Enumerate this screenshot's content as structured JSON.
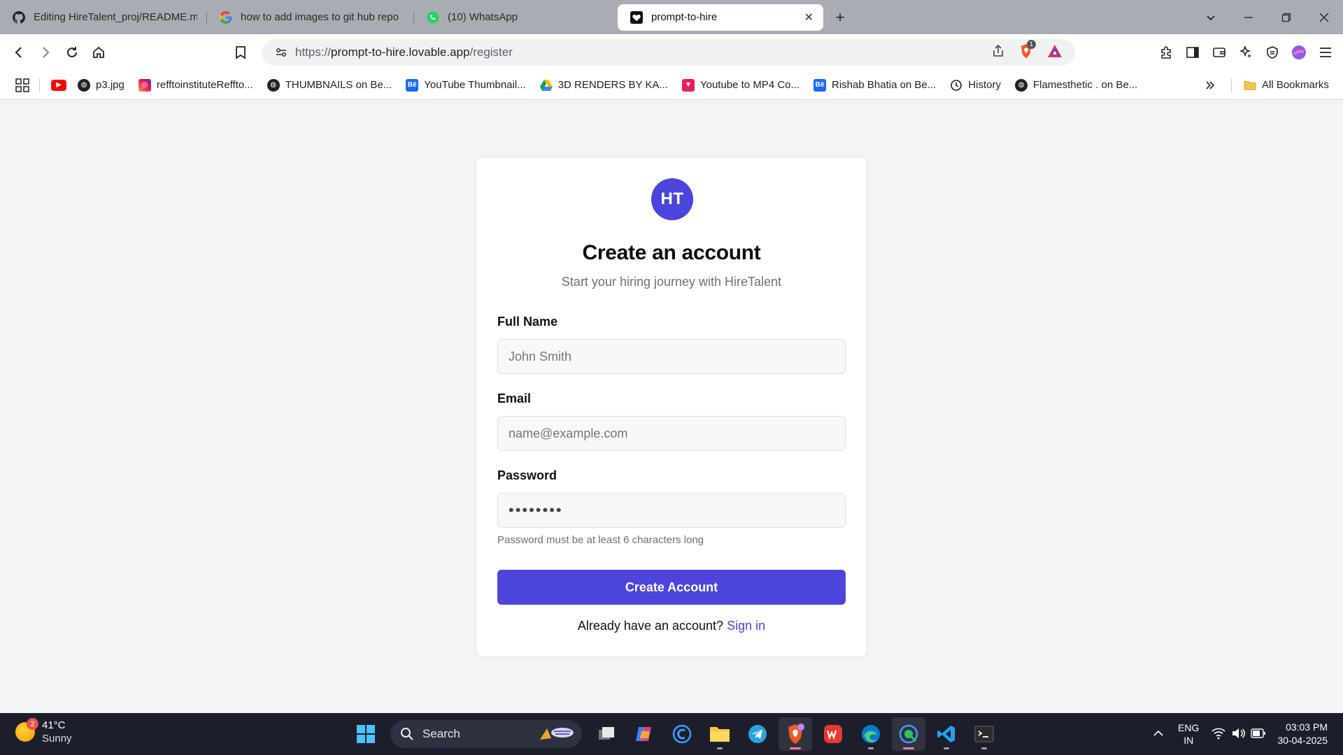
{
  "browser": {
    "tabs": [
      {
        "title": "Editing HireTalent_proj/README.md",
        "icon": "github-icon",
        "active": false
      },
      {
        "title": "how to add images to git hub repo",
        "icon": "google-icon",
        "active": false
      },
      {
        "title": "(10) WhatsApp",
        "icon": "whatsapp-icon",
        "active": false
      },
      {
        "title": "prompt-to-hire",
        "icon": "heart-icon",
        "active": true
      }
    ],
    "new_tab": "+",
    "address": {
      "scheme": "https://",
      "host": "prompt-to-hire.lovable.app",
      "path": "/register"
    },
    "shields_count": "1",
    "bookmarks": [
      {
        "label": "p3.jpg",
        "icon": "globe-icon"
      },
      {
        "label": "refftoinstituteReffto...",
        "icon": "instagram-icon"
      },
      {
        "label": "THUMBNAILS on Be...",
        "icon": "globe-icon"
      },
      {
        "label": "YouTube Thumbnail...",
        "icon": "behance-icon"
      },
      {
        "label": "3D RENDERS BY KA...",
        "icon": "drive-icon"
      },
      {
        "label": "Youtube to MP4 Co...",
        "icon": "download-icon"
      },
      {
        "label": "Rishab Bhatia on Be...",
        "icon": "behance-icon"
      },
      {
        "label": "History",
        "icon": "history-icon"
      },
      {
        "label": "Flamesthetic . on Be...",
        "icon": "globe-icon"
      }
    ],
    "all_bookmarks": "All Bookmarks"
  },
  "form": {
    "logo": "HT",
    "heading": "Create an account",
    "subheading": "Start your hiring journey with HireTalent",
    "name_label": "Full Name",
    "name_placeholder": "John Smith",
    "email_label": "Email",
    "email_placeholder": "name@example.com",
    "password_label": "Password",
    "password_value": "••••••••",
    "password_hint": "Password must be at least 6 characters long",
    "submit": "Create Account",
    "signin_prompt": "Already have an account?",
    "signin_link": "Sign in"
  },
  "taskbar": {
    "weather_temp": "41°C",
    "weather_desc": "Sunny",
    "weather_badge": "2",
    "search_placeholder": "Search",
    "lang_top": "ENG",
    "lang_bottom": "IN",
    "time": "03:03 PM",
    "date": "30-04-2025"
  },
  "colors": {
    "brand": "#4b45db",
    "page_bg": "#f3f4f6",
    "tabstrip": "#a9acb3",
    "taskbar": "#1c1f2b"
  }
}
